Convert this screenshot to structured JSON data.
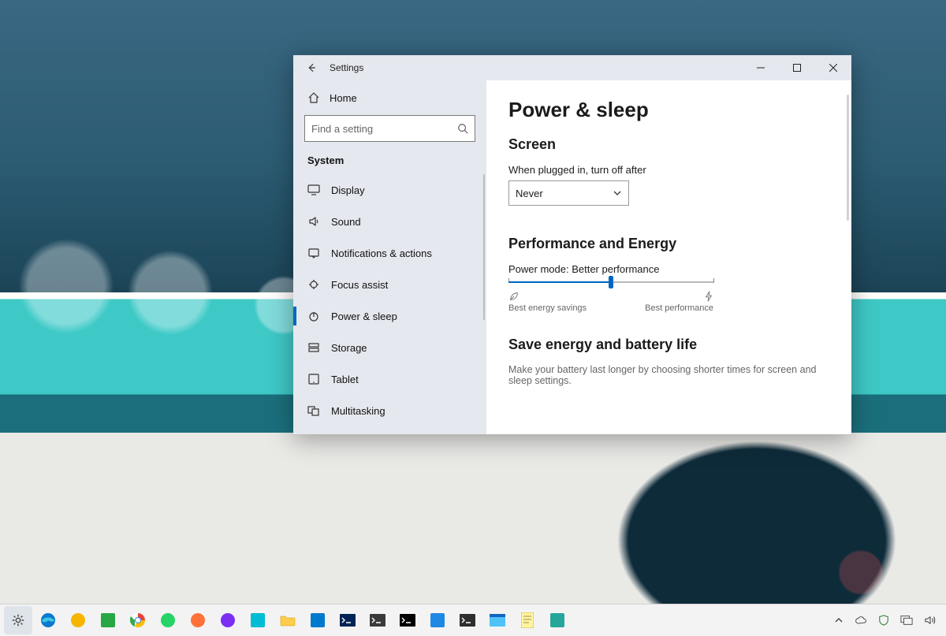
{
  "window": {
    "title": "Settings",
    "home_label": "Home",
    "search_placeholder": "Find a setting",
    "breadcrumb": "System",
    "nav_items": [
      {
        "icon": "display",
        "label": "Display"
      },
      {
        "icon": "sound",
        "label": "Sound"
      },
      {
        "icon": "notif",
        "label": "Notifications & actions"
      },
      {
        "icon": "focus",
        "label": "Focus assist"
      },
      {
        "icon": "power",
        "label": "Power & sleep",
        "selected": true
      },
      {
        "icon": "storage",
        "label": "Storage"
      },
      {
        "icon": "tablet",
        "label": "Tablet"
      },
      {
        "icon": "multi",
        "label": "Multitasking"
      }
    ]
  },
  "content": {
    "page_title": "Power & sleep",
    "screen": {
      "heading": "Screen",
      "label": "When plugged in, turn off after",
      "value": "Never"
    },
    "perf": {
      "heading": "Performance and Energy",
      "mode_label": "Power mode: Better performance",
      "left_label": "Best energy savings",
      "right_label": "Best performance",
      "slider_pos_percent": 50
    },
    "energy": {
      "heading": "Save energy and battery life",
      "desc": "Make your battery last longer by choosing shorter times for screen and sleep settings."
    }
  },
  "taskbar": {
    "pinned": [
      {
        "name": "settings-icon",
        "color": "#444",
        "glyph": "gear"
      },
      {
        "name": "edge-icon",
        "color": "#0b78d0",
        "glyph": "edge"
      },
      {
        "name": "chrome-canary-icon",
        "color": "#f7b500",
        "glyph": "circle"
      },
      {
        "name": "app-green-icon",
        "color": "#28a745",
        "glyph": "square"
      },
      {
        "name": "chrome-icon",
        "color": "#ea4335",
        "glyph": "chrome"
      },
      {
        "name": "whatsapp-icon",
        "color": "#25d366",
        "glyph": "circle"
      },
      {
        "name": "firefox-icon",
        "color": "#ff7139",
        "glyph": "circle"
      },
      {
        "name": "firefox-nightly-icon",
        "color": "#7b2ff2",
        "glyph": "circle"
      },
      {
        "name": "app-cyan-icon",
        "color": "#00bcd4",
        "glyph": "square"
      },
      {
        "name": "file-explorer-icon",
        "color": "#ffcc4d",
        "glyph": "folder"
      },
      {
        "name": "vscode-icon",
        "color": "#007acc",
        "glyph": "square"
      },
      {
        "name": "powershell-icon",
        "color": "#012456",
        "glyph": "terminal"
      },
      {
        "name": "terminal-alt-icon",
        "color": "#3a3a3a",
        "glyph": "terminal"
      },
      {
        "name": "cmd-icon",
        "color": "#000000",
        "glyph": "terminal"
      },
      {
        "name": "app-blue-icon",
        "color": "#1e88e5",
        "glyph": "square"
      },
      {
        "name": "terminal-dark-icon",
        "color": "#2e2e2e",
        "glyph": "terminal"
      },
      {
        "name": "app-window-icon",
        "color": "#4fc3f7",
        "glyph": "window"
      },
      {
        "name": "notepad-icon",
        "color": "#fff59d",
        "glyph": "note"
      },
      {
        "name": "app-teal-icon",
        "color": "#26a69a",
        "glyph": "square"
      }
    ],
    "active_index": 0,
    "tray": [
      "chevron-up",
      "onedrive",
      "security",
      "network",
      "speaker"
    ]
  }
}
